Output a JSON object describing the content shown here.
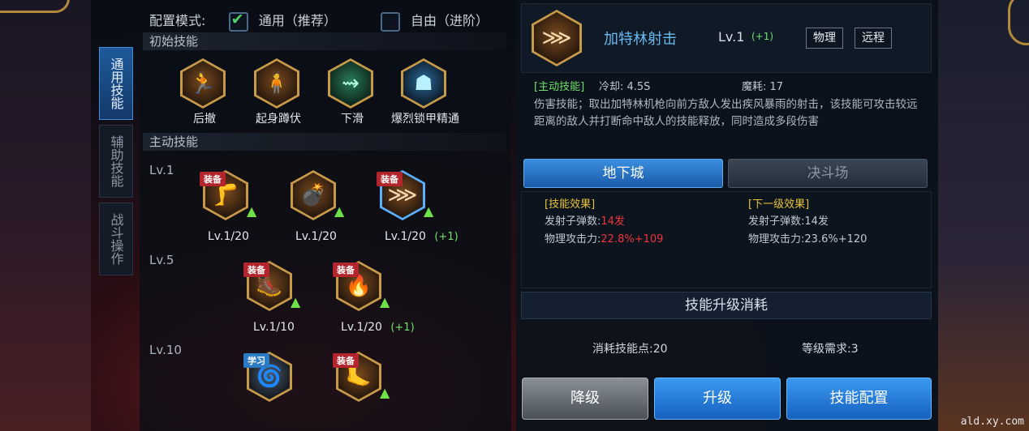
{
  "side_tabs": [
    {
      "label": "通用技能",
      "active": true
    },
    {
      "label": "辅助技能",
      "active": false
    },
    {
      "label": "战斗操作",
      "active": false
    }
  ],
  "config": {
    "label": "配置模式:",
    "option_general": "通用（推荐）",
    "option_general_checked": true,
    "option_free": "自由（进阶）",
    "option_free_checked": false
  },
  "initial_section": {
    "title": "初始技能",
    "skills": [
      {
        "name": "后撤",
        "icon": "backstep-icon"
      },
      {
        "name": "起身蹲伏",
        "icon": "crouch-icon"
      },
      {
        "name": "下滑",
        "icon": "slide-icon"
      },
      {
        "name": "爆烈锁甲精通",
        "icon": "armor-icon"
      }
    ]
  },
  "active_section": {
    "title": "主动技能",
    "tiers": [
      {
        "label": "Lv.1",
        "skills": [
          {
            "level": "Lv.1/20",
            "plus": "",
            "badge": "装备",
            "icon": "kick-icon",
            "upgradable": true
          },
          {
            "level": "Lv.1/20",
            "plus": "",
            "badge": "",
            "icon": "grenade-icon",
            "upgradable": true
          },
          {
            "level": "Lv.1/20",
            "plus": "(+1)",
            "badge": "装备",
            "icon": "gatling-icon",
            "upgradable": true,
            "selected": true
          }
        ]
      },
      {
        "label": "Lv.5",
        "skills": [
          {
            "level": "Lv.1/10",
            "plus": "",
            "badge": "装备",
            "icon": "slide-kick-icon",
            "upgradable": true
          },
          {
            "level": "Lv.1/20",
            "plus": "(+1)",
            "badge": "装备",
            "icon": "fire-icon",
            "upgradable": true
          }
        ]
      },
      {
        "label": "Lv.10",
        "skills": [
          {
            "level": "",
            "plus": "",
            "badge": "学习",
            "icon": "spin-icon",
            "upgradable": false
          },
          {
            "level": "",
            "plus": "",
            "badge": "装备",
            "icon": "flame-kick-icon",
            "upgradable": true
          }
        ]
      }
    ]
  },
  "detail": {
    "name": "加特林射击",
    "level": "Lv.1",
    "level_plus": "(+1)",
    "tags": [
      "物理",
      "远程"
    ],
    "type_label": "[主动技能]",
    "cooldown": "冷却: 4.5S",
    "mana": "魔耗: 17",
    "description": "伤害技能；取出加特林机枪向前方敌人发出疾风暴雨的射击，该技能可攻击较远距离的敌人并打断命中敌人的技能释放，同时造成多段伤害",
    "modes": [
      "地下城",
      "决斗场"
    ],
    "current_effect": {
      "title": "[技能效果]",
      "line1_label": "发射子弹数:",
      "line1_value": "14发",
      "line2_label": "物理攻击力:",
      "line2_value": "22.8%+109"
    },
    "next_effect": {
      "title": "[下一级效果]",
      "line1_label": "发射子弹数:",
      "line1_value": "14发",
      "line2_label": "物理攻击力:",
      "line2_value": "23.6%+120"
    },
    "cost_title": "技能升级消耗",
    "cost_points": "消耗技能点:20",
    "level_req": "等级需求:3",
    "buttons": [
      "降级",
      "升级",
      "技能配置"
    ]
  },
  "watermark": "ald.xy.com",
  "colors": {
    "accent_blue": "#3a8ee0",
    "gold": "#c79a4a",
    "green_plus": "#6ee06a",
    "red_value": "#f0343a",
    "yellow_title": "#e8c23a"
  }
}
